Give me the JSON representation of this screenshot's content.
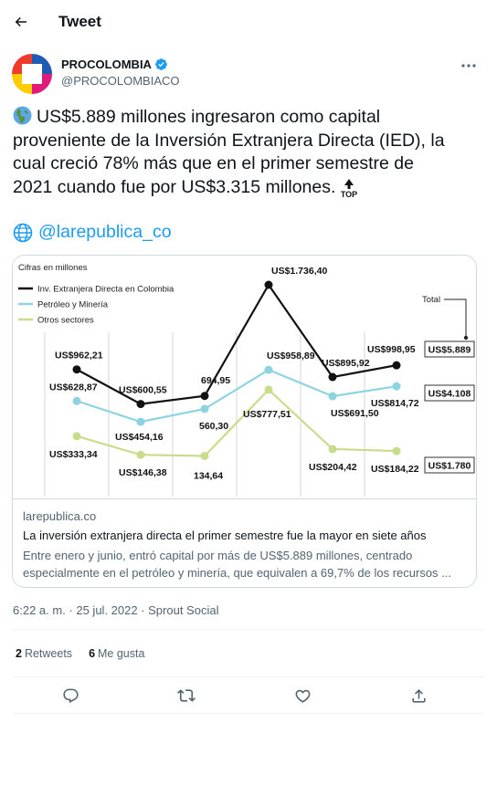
{
  "header": {
    "title": "Tweet"
  },
  "author": {
    "name": "PROCOLOMBIA",
    "handle": "@PROCOLOMBIACO",
    "verified": true
  },
  "tweet": {
    "text_lines": [
      "US$5.889 millones ingresaron como capital",
      "proveniente de la Inversión Extranjera Directa (IED), la",
      "cual creció 78% más que en el primer semestre de",
      "2021 cuando fue por US$3.315 millones."
    ],
    "top_badge": "TOP",
    "mention": "@larepublica_co"
  },
  "card": {
    "domain": "larepublica.co",
    "title": "La inversión extranjera directa el primer semestre fue la mayor en siete años",
    "description": "Entre enero y junio, entró capital por más de US$5.889 millones, centrado especialmente en el petróleo y minería, que equivalen a 69,7% de los recursos ..."
  },
  "chart_data": {
    "type": "line",
    "subtitle": "Cifras en millones",
    "x": [
      1,
      2,
      3,
      4,
      5,
      6
    ],
    "series": [
      {
        "name": "Inv. Extranjera Directa en Colombia",
        "color": "#111111",
        "values": [
          962.21,
          600.55,
          694.95,
          1736.4,
          895.92,
          998.95
        ],
        "labels": [
          "US$962,21",
          "US$600,55",
          "694,95",
          "US$1.736,40",
          "US$895,92",
          "US$998,95"
        ]
      },
      {
        "name": "Petróleo y Minería",
        "color": "#8dd3e0",
        "values": [
          628.87,
          454.16,
          560.3,
          958.89,
          691.5,
          814.72
        ],
        "labels": [
          "US$628,87",
          "US$454,16",
          "560,30",
          "US$958,89",
          "US$691,50",
          "US$814,72"
        ]
      },
      {
        "name": "Otros sectores",
        "color": "#c8dc8c",
        "values": [
          333.34,
          146.38,
          134.64,
          777.51,
          204.42,
          184.22
        ],
        "labels": [
          "US$333,34",
          "US$146,38",
          "134,64",
          "US$777,51",
          "US$204,42",
          "US$184,22"
        ]
      }
    ],
    "total_label": "Total",
    "totals": [
      "US$5.889",
      "US$4.108",
      "US$1.780"
    ],
    "grid": true,
    "legend_position": "top-left"
  },
  "meta": {
    "timestamp": "6:22 a. m. · 25 jul. 2022 · Sprout Social"
  },
  "stats": {
    "retweets_count": "2",
    "retweets_label": "Retweets",
    "likes_count": "6",
    "likes_label": "Me gusta"
  },
  "icons": [
    "back-arrow-icon",
    "verified-badge-icon",
    "more-icon",
    "globe-icon",
    "reply-icon",
    "retweet-icon",
    "like-icon",
    "share-icon"
  ],
  "colors": {
    "link": "#1d9bf0",
    "verified": "#1d9bf0",
    "muted": "#536471"
  }
}
